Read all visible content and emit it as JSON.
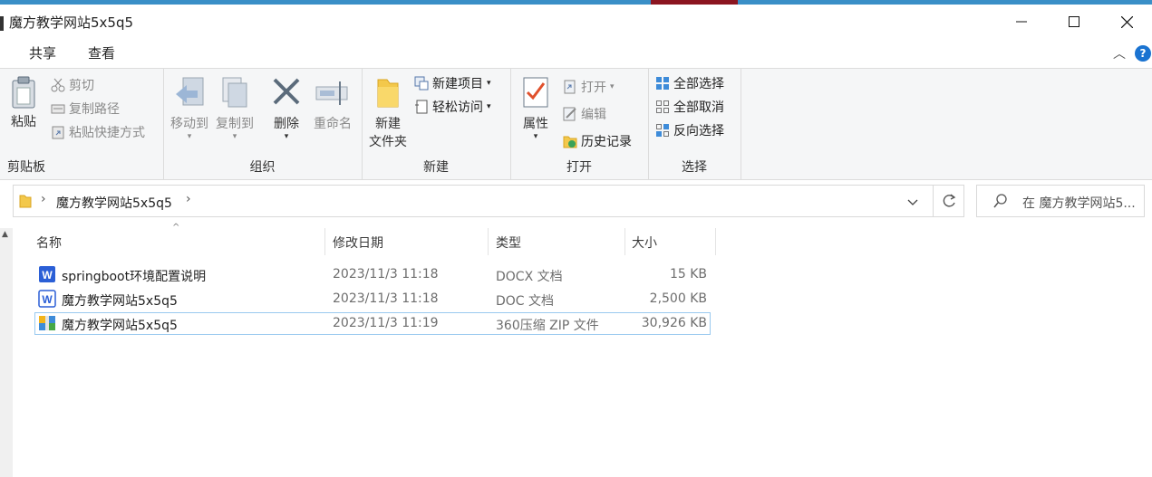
{
  "window": {
    "title": "魔方教学网站5x5q5"
  },
  "tabs": [
    "共享",
    "查看"
  ],
  "ribbon": {
    "clipboard": {
      "paste": "粘贴",
      "cut": "剪切",
      "copy_path": "复制路径",
      "paste_shortcut": "粘贴快捷方式",
      "group": "剪贴板"
    },
    "organize": {
      "move_to": "移动到",
      "copy_to": "复制到",
      "delete": "删除",
      "rename": "重命名",
      "group": "组织"
    },
    "new": {
      "new_folder_line1": "新建",
      "new_folder_line2": "文件夹",
      "new_item": "新建项目",
      "easy_access": "轻松访问",
      "group": "新建"
    },
    "open": {
      "properties": "属性",
      "open": "打开",
      "edit": "编辑",
      "history": "历史记录",
      "group": "打开"
    },
    "select": {
      "select_all": "全部选择",
      "select_none": "全部取消",
      "invert": "反向选择",
      "group": "选择"
    }
  },
  "address": {
    "path": "魔方教学网站5x5q5"
  },
  "search": {
    "placeholder": "在 魔方教学网站5..."
  },
  "columns": {
    "name": "名称",
    "modified": "修改日期",
    "type": "类型",
    "size": "大小"
  },
  "files": [
    {
      "name": "springboot环境配置说明",
      "modified": "2023/11/3 11:18",
      "type": "DOCX 文档",
      "size": "15 KB",
      "icon": "word-doc-icon"
    },
    {
      "name": "魔方教学网站5x5q5",
      "modified": "2023/11/3 11:18",
      "type": "DOC 文档",
      "size": "2,500 KB",
      "icon": "word-doc-icon"
    },
    {
      "name": "魔方教学网站5x5q5",
      "modified": "2023/11/3 11:19",
      "type": "360压缩 ZIP 文件",
      "size": "30,926 KB",
      "icon": "zip-archive-icon",
      "selected": true
    }
  ],
  "colors": {
    "accent": "#1a73d1",
    "selection_border": "#99c9ef"
  }
}
